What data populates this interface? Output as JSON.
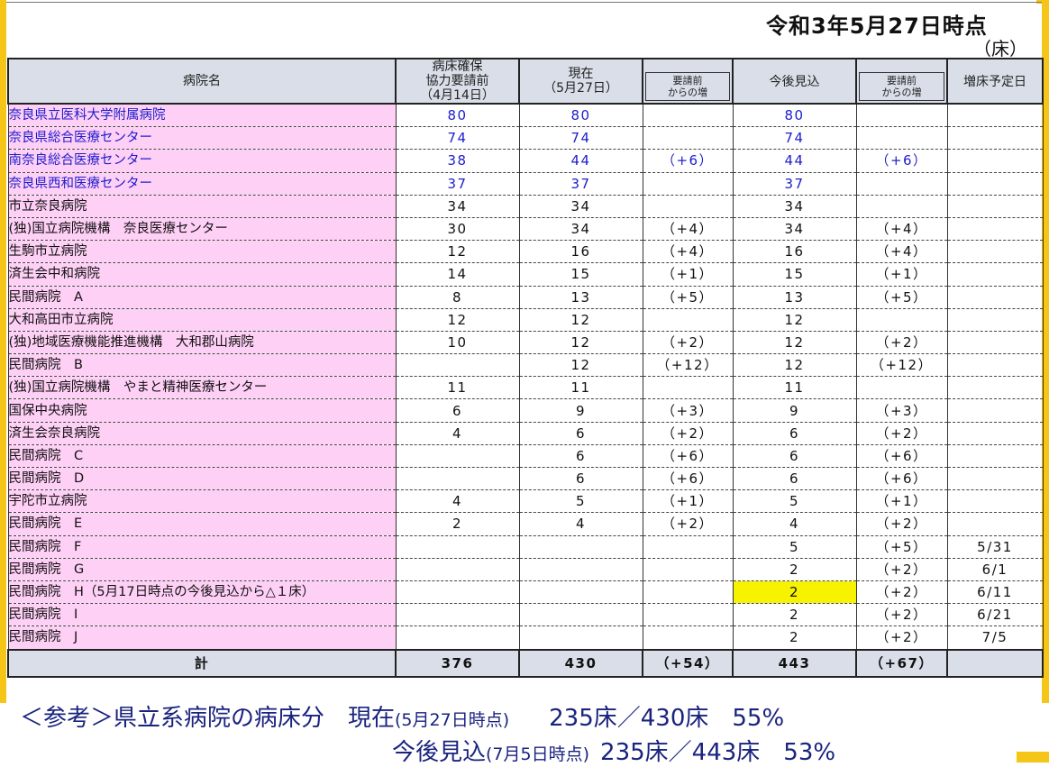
{
  "date_title": "令和3年5月27日時点",
  "unit": "（床）",
  "headers": {
    "name": "病院名",
    "before_line1": "病床確保",
    "before_line2": "協力要請前",
    "before_line3": "（4月14日）",
    "current_line1": "現在",
    "current_line2": "（5月27日）",
    "inc": "要請前",
    "inc2": "からの増",
    "future": "今後見込",
    "schedule": "増床予定日"
  },
  "rows": [
    {
      "name": "奈良県立医科大学附属病院",
      "before": "80",
      "current": "80",
      "inc1": "",
      "future": "80",
      "inc2": "",
      "date": ""
    },
    {
      "name": "奈良県総合医療センター",
      "before": "74",
      "current": "74",
      "inc1": "",
      "future": "74",
      "inc2": "",
      "date": ""
    },
    {
      "name": "南奈良総合医療センター",
      "before": "38",
      "current": "44",
      "inc1": "（+6）",
      "future": "44",
      "inc2": "（+6）",
      "date": ""
    },
    {
      "name": "奈良県西和医療センター",
      "before": "37",
      "current": "37",
      "inc1": "",
      "future": "37",
      "inc2": "",
      "date": ""
    },
    {
      "name": "市立奈良病院",
      "before": "34",
      "current": "34",
      "inc1": "",
      "future": "34",
      "inc2": "",
      "date": ""
    },
    {
      "name": "(独)国立病院機構　奈良医療センター",
      "before": "30",
      "current": "34",
      "inc1": "（+4）",
      "future": "34",
      "inc2": "（+4）",
      "date": ""
    },
    {
      "name": "生駒市立病院",
      "before": "12",
      "current": "16",
      "inc1": "（+4）",
      "future": "16",
      "inc2": "（+4）",
      "date": ""
    },
    {
      "name": "済生会中和病院",
      "before": "14",
      "current": "15",
      "inc1": "（+1）",
      "future": "15",
      "inc2": "（+1）",
      "date": ""
    },
    {
      "name": "民間病院　A",
      "before": "8",
      "current": "13",
      "inc1": "（+5）",
      "future": "13",
      "inc2": "（+5）",
      "date": ""
    },
    {
      "name": "大和高田市立病院",
      "before": "12",
      "current": "12",
      "inc1": "",
      "future": "12",
      "inc2": "",
      "date": ""
    },
    {
      "name": "(独)地域医療機能推進機構　大和郡山病院",
      "before": "10",
      "current": "12",
      "inc1": "（+2）",
      "future": "12",
      "inc2": "（+2）",
      "date": ""
    },
    {
      "name": "民間病院　B",
      "before": "",
      "current": "12",
      "inc1": "（+12）",
      "future": "12",
      "inc2": "（+12）",
      "date": ""
    },
    {
      "name": "(独)国立病院機構　やまと精神医療センター",
      "before": "11",
      "current": "11",
      "inc1": "",
      "future": "11",
      "inc2": "",
      "date": ""
    },
    {
      "name": "国保中央病院",
      "before": "6",
      "current": "9",
      "inc1": "（+3）",
      "future": "9",
      "inc2": "（+3）",
      "date": ""
    },
    {
      "name": "済生会奈良病院",
      "before": "4",
      "current": "6",
      "inc1": "（+2）",
      "future": "6",
      "inc2": "（+2）",
      "date": ""
    },
    {
      "name": "民間病院　C",
      "before": "",
      "current": "6",
      "inc1": "（+6）",
      "future": "6",
      "inc2": "（+6）",
      "date": ""
    },
    {
      "name": "民間病院　D",
      "before": "",
      "current": "6",
      "inc1": "（+6）",
      "future": "6",
      "inc2": "（+6）",
      "date": ""
    },
    {
      "name": "宇陀市立病院",
      "before": "4",
      "current": "5",
      "inc1": "（+1）",
      "future": "5",
      "inc2": "（+1）",
      "date": ""
    },
    {
      "name": "民間病院　E",
      "before": "2",
      "current": "4",
      "inc1": "（+2）",
      "future": "4",
      "inc2": "（+2）",
      "date": ""
    },
    {
      "name": "民間病院　F",
      "before": "",
      "current": "",
      "inc1": "",
      "future": "5",
      "inc2": "（+5）",
      "date": "5/31"
    },
    {
      "name": "民間病院　G",
      "before": "",
      "current": "",
      "inc1": "",
      "future": "2",
      "inc2": "（+2）",
      "date": "6/1"
    },
    {
      "name": "民間病院　H（5月17日時点の今後見込から△１床）",
      "before": "",
      "current": "",
      "inc1": "",
      "future": "2",
      "inc2": "（+2）",
      "date": "6/11"
    },
    {
      "name": "民間病院　I",
      "before": "",
      "current": "",
      "inc1": "",
      "future": "2",
      "inc2": "（+2）",
      "date": "6/21"
    },
    {
      "name": "民間病院　J",
      "before": "",
      "current": "",
      "inc1": "",
      "future": "2",
      "inc2": "（+2）",
      "date": "7/5"
    }
  ],
  "total": {
    "label": "計",
    "before": "376",
    "current": "430",
    "inc1": "（+54）",
    "future": "443",
    "inc2": "（+67）"
  },
  "note": {
    "line1_prefix": "＜参考＞県立系病院の病床分　現在",
    "line1_small": "(5月27日時点)",
    "line1_value": "235床／430床　55%",
    "line2_prefix": "今後見込",
    "line2_small": "(7月5日時点)",
    "line2_value": "235床／443床　53%"
  },
  "colors": {
    "name_bg": "#ffd0f6",
    "header_bg": "#d9dee8",
    "public_text": "#1d1dcc",
    "highlight": "#f7f300",
    "frame": "#f5c518",
    "note_text": "#1a237e"
  }
}
